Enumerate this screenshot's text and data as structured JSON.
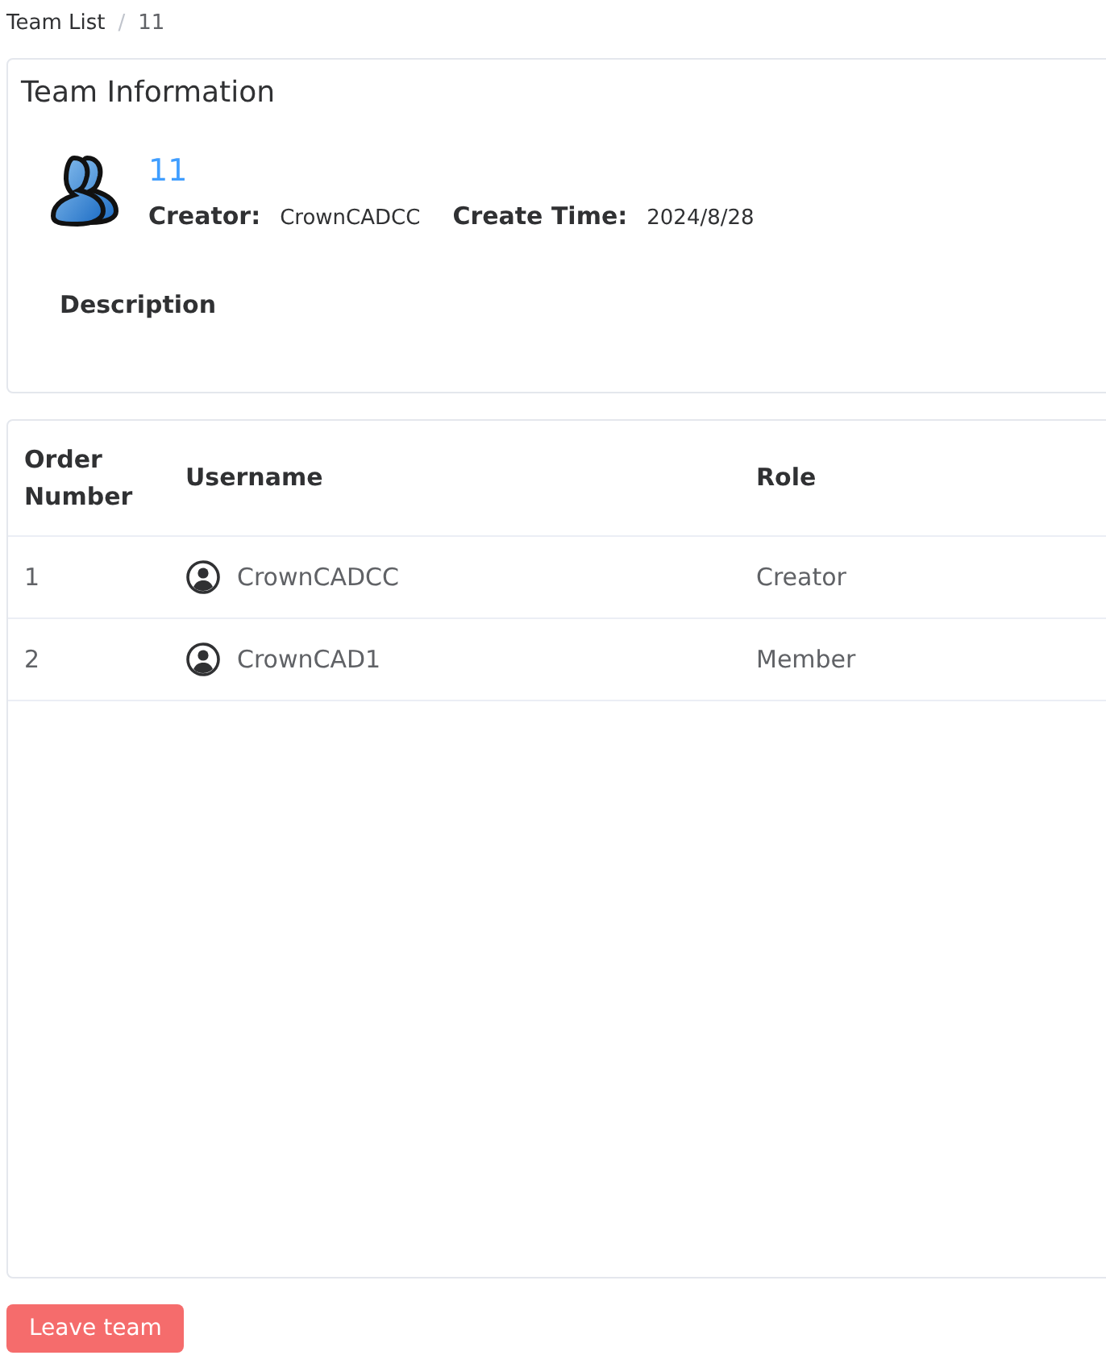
{
  "breadcrumb": {
    "items": [
      "Team List",
      "11"
    ],
    "separator": "/"
  },
  "team_card": {
    "title": "Team Information",
    "team_name": "11",
    "creator_label": "Creator:",
    "creator": "CrownCADCC",
    "create_time_label": "Create Time:",
    "create_time": "2024/8/28",
    "description_label": "Description"
  },
  "table": {
    "columns": [
      "Order Number",
      "Username",
      "Role"
    ],
    "rows": [
      {
        "order": "1",
        "username": "CrownCADCC",
        "role": "Creator"
      },
      {
        "order": "2",
        "username": "CrownCAD1",
        "role": "Member"
      }
    ]
  },
  "buttons": [
    {
      "label": "Leave team",
      "kind": "danger"
    }
  ]
}
